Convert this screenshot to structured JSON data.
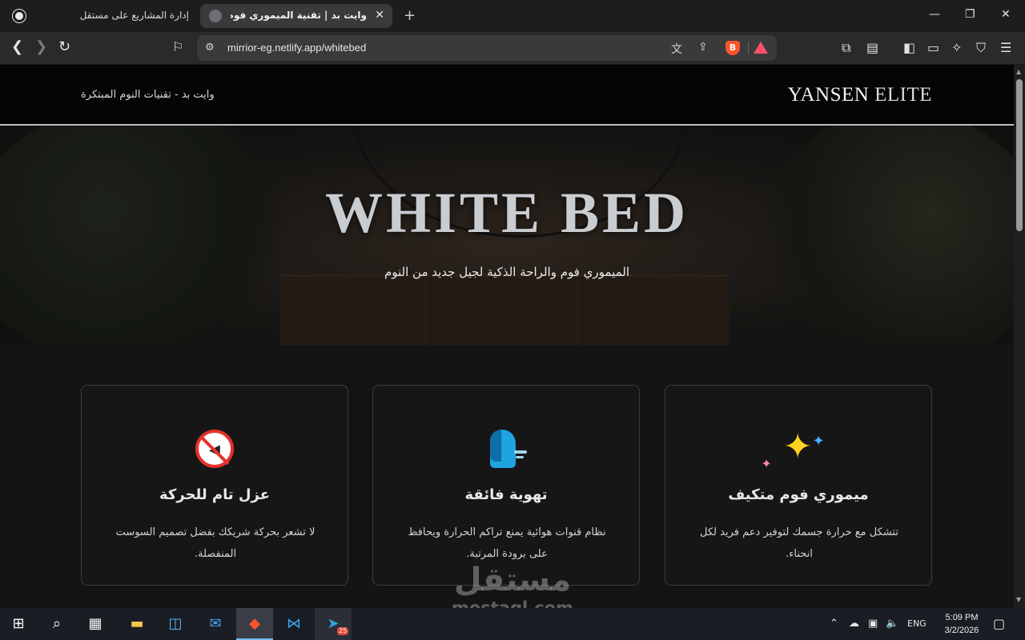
{
  "browser": {
    "tabs": [
      {
        "title": "إدارة المشاريع على مستقل",
        "active": false
      },
      {
        "title": "وايت بد | تقنية الميموري فوم والراحة",
        "active": true
      }
    ],
    "new_tab_icon": "plus-icon",
    "window_controls": {
      "minimize": "—",
      "maximize": "❐",
      "close": "✕"
    },
    "url": "mirrior-eg.netlify.app/whitebed",
    "nav": {
      "back": "❮",
      "forward": "❯",
      "reload": "↻"
    },
    "accent": "#fb542b"
  },
  "site": {
    "header": {
      "brand_main": "YANSEN",
      "brand_sub": "ELITE",
      "tagline": "وايت بد - تقنيات النوم المبتكرة"
    },
    "hero": {
      "title": "WHITE BED",
      "subtitle": "الميموري فوم والراحة الذكية لجيل جديد من النوم"
    },
    "features": [
      {
        "icon": "sparkles-icon",
        "title": "ميموري فوم متكيف",
        "text": "تتشكل مع حرارة جسمك لتوفير دعم فريد لكل انحناء."
      },
      {
        "icon": "face-exhaling-icon",
        "title": "تهوية فائقة",
        "text": "نظام قنوات هوائية يمنع تراكم الحرارة ويحافظ على برودة المرتبة."
      },
      {
        "icon": "no-sound-icon",
        "title": "عزل تام للحركة",
        "text": "لا تشعر بحركة شريكك بفضل تصميم السوست المنفصلة."
      }
    ]
  },
  "watermark": {
    "arabic": "مستقل",
    "latin": "mostaql.com"
  },
  "taskbar": {
    "language": "ENG",
    "time": "5:09 PM",
    "date": "3/2/2026",
    "telegram_badge": "25"
  }
}
